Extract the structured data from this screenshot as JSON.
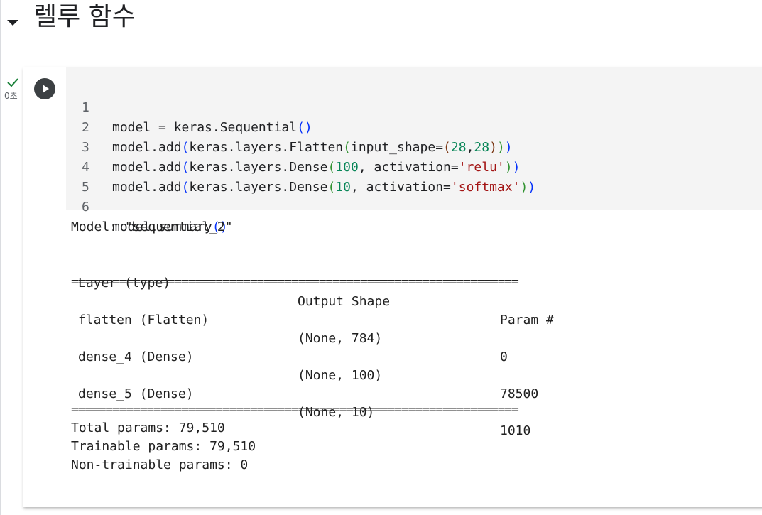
{
  "section": {
    "title": "렐루 함수"
  },
  "execution": {
    "time": "0초"
  },
  "code": {
    "lines": [
      {
        "no": "1",
        "text": "model = keras.Sequential()"
      },
      {
        "no": "2",
        "text": "model.add(keras.layers.Flatten(input_shape=(28,28)))"
      },
      {
        "no": "3",
        "text": "model.add(keras.layers.Dense(100, activation='relu'))"
      },
      {
        "no": "4",
        "text": "model.add(keras.layers.Dense(10, activation='softmax'))"
      },
      {
        "no": "5",
        "text": ""
      },
      {
        "no": "6",
        "text": "model.summary()"
      }
    ]
  },
  "output": {
    "model_name": "Model: \"sequential_2\"",
    "dash_rule": "_________________________________________________________________",
    "eq_rule": "=================================================================",
    "header": {
      "layer": "Layer (type)",
      "shape": "Output Shape",
      "params": "Param #"
    },
    "rows": [
      {
        "layer": "flatten (Flatten)",
        "shape": "(None, 784)",
        "params": "0"
      },
      {
        "layer": "dense_4 (Dense)",
        "shape": "(None, 100)",
        "params": "78500"
      },
      {
        "layer": "dense_5 (Dense)",
        "shape": "(None, 10)",
        "params": "1010"
      }
    ],
    "total": "Total params: 79,510",
    "trainable": "Trainable params: 79,510",
    "non_trainable": "Non-trainable params: 0"
  }
}
